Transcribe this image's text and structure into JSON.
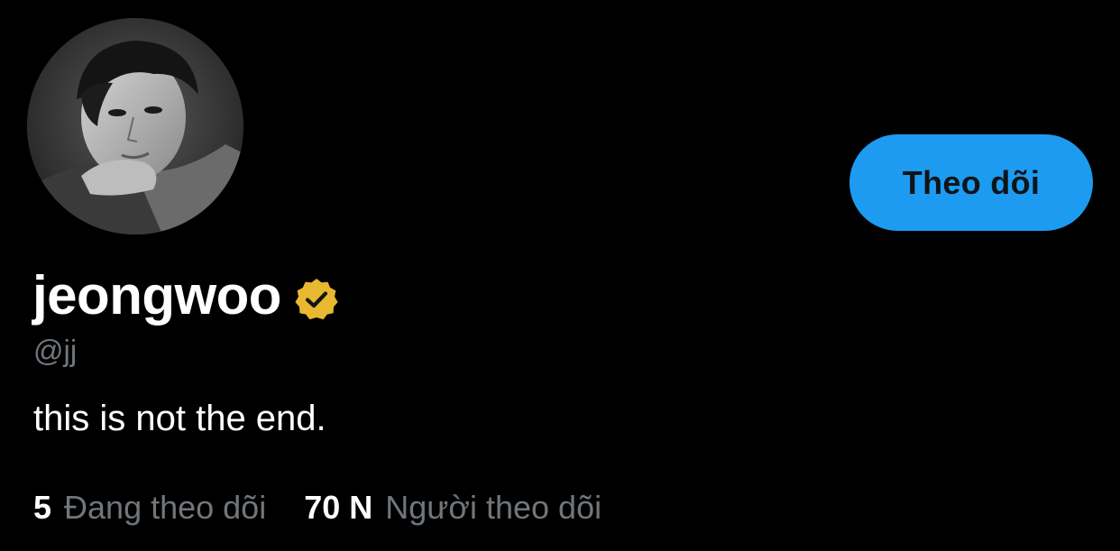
{
  "profile": {
    "display_name": "jeongwoo",
    "handle": "@jj",
    "bio": "this is not the end.",
    "verified_icon": "verified-badge-gold-icon",
    "avatar_alt": "profile photo"
  },
  "actions": {
    "follow_label": "Theo dõi"
  },
  "stats": {
    "following_count": "5",
    "following_label": "Đang theo dõi",
    "followers_count": "70 N",
    "followers_label": "Người theo dõi"
  },
  "colors": {
    "background": "#000000",
    "accent": "#1d9bf0",
    "verified_gold": "#e8b830",
    "muted_text": "#71767b",
    "primary_text": "#ffffff"
  }
}
